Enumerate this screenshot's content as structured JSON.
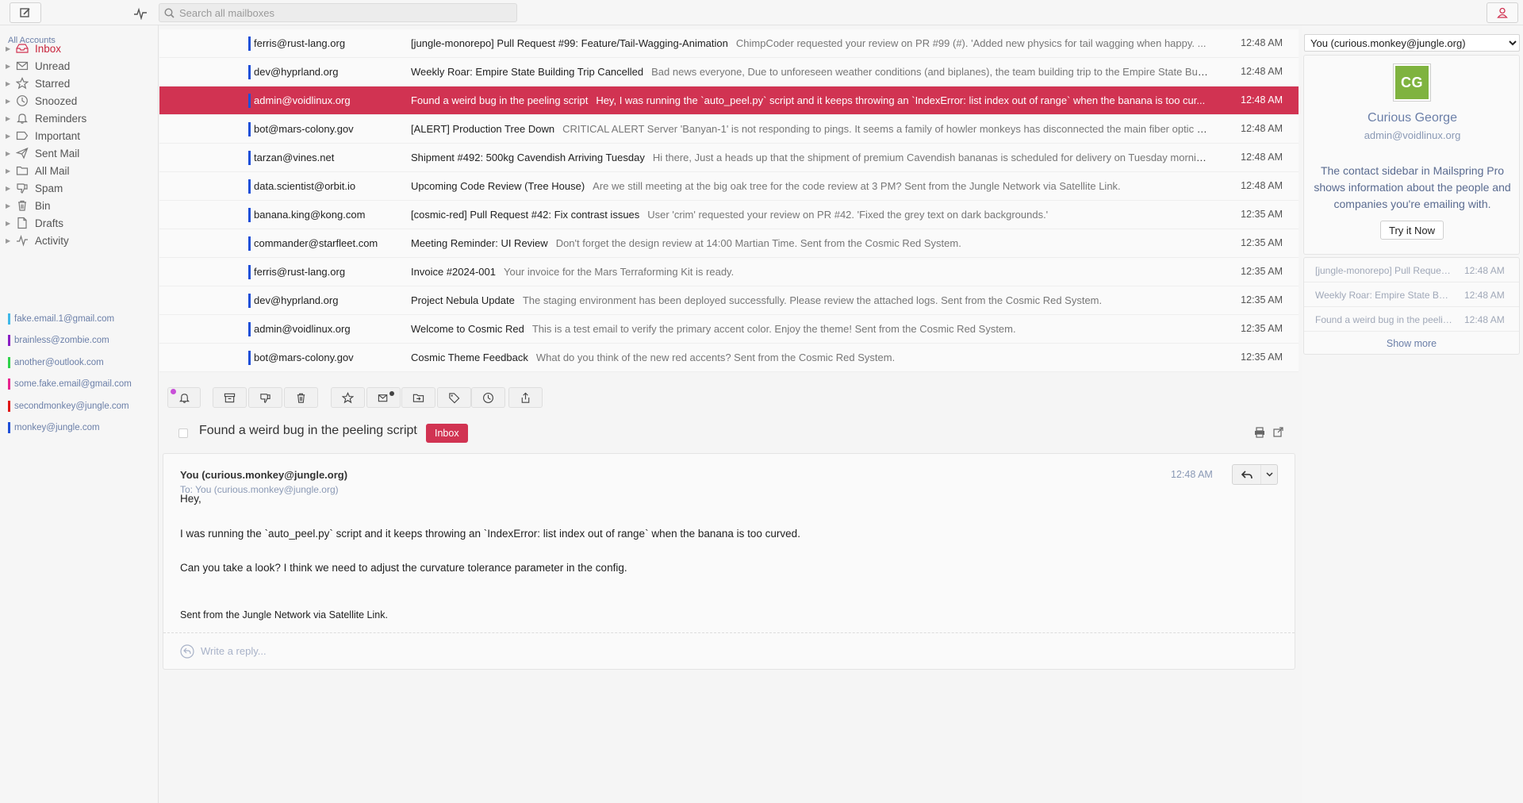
{
  "search": {
    "placeholder": "Search all mailboxes"
  },
  "sidebar": {
    "heading": "All Accounts",
    "folders": [
      {
        "label": "Inbox",
        "icon": "inbox-icon"
      },
      {
        "label": "Unread",
        "icon": "unread-icon"
      },
      {
        "label": "Starred",
        "icon": "star-icon"
      },
      {
        "label": "Snoozed",
        "icon": "clock-icon"
      },
      {
        "label": "Reminders",
        "icon": "bell-icon"
      },
      {
        "label": "Important",
        "icon": "label-icon"
      },
      {
        "label": "Sent Mail",
        "icon": "send-icon"
      },
      {
        "label": "All Mail",
        "icon": "folder-icon"
      },
      {
        "label": "Spam",
        "icon": "thumbs-down-icon"
      },
      {
        "label": "Bin",
        "icon": "trash-icon"
      },
      {
        "label": "Drafts",
        "icon": "draft-icon"
      },
      {
        "label": "Activity",
        "icon": "activity-icon"
      }
    ],
    "accounts": [
      {
        "label": "fake.email.1@gmail.com",
        "color": "#3fb8e8"
      },
      {
        "label": "brainless@zombie.com",
        "color": "#8a1fc4"
      },
      {
        "label": "another@outlook.com",
        "color": "#2fd24a"
      },
      {
        "label": "some.fake.email@gmail.com",
        "color": "#e8248f"
      },
      {
        "label": "secondmonkey@jungle.com",
        "color": "#e01616"
      },
      {
        "label": "monkey@jungle.com",
        "color": "#1f4fd8"
      }
    ]
  },
  "messages": [
    {
      "sender": "ferris@rust-lang.org",
      "subject": "[jungle-monorepo] Pull Request #99: Feature/Tail-Wagging-Animation",
      "snippet": "ChimpCoder requested your review on PR #99 (#). 'Added new physics for tail wagging when happy. ...",
      "time": "12:48 AM"
    },
    {
      "sender": "dev@hyprland.org",
      "subject": "Weekly Roar: Empire State Building Trip Cancelled",
      "snippet": "Bad news everyone, Due to unforeseen weather conditions (and biplanes), the team building trip to the Empire State Build...",
      "time": "12:48 AM"
    },
    {
      "sender": "admin@voidlinux.org",
      "subject": "Found a weird bug in the peeling script",
      "snippet": "Hey, I was running the `auto_peel.py` script and it keeps throwing an `IndexError: list index out of range` when the banana is too cur...",
      "time": "12:48 AM"
    },
    {
      "sender": "bot@mars-colony.gov",
      "subject": "[ALERT] Production Tree Down",
      "snippet": "CRITICAL ALERT Server 'Banyan-1' is not responding to pings. It seems a family of howler monkeys has disconnected the main fiber optic vi...",
      "time": "12:48 AM"
    },
    {
      "sender": "tarzan@vines.net",
      "subject": "Shipment #492: 500kg Cavendish Arriving Tuesday",
      "snippet": "Hi there, Just a heads up that the shipment of premium Cavendish bananas is scheduled for delivery on Tuesday morning...",
      "time": "12:48 AM"
    },
    {
      "sender": "data.scientist@orbit.io",
      "subject": "Upcoming Code Review (Tree House)",
      "snippet": "Are we still meeting at the big oak tree for the code review at 3 PM? Sent from the Jungle Network via Satellite Link.",
      "time": "12:48 AM"
    },
    {
      "sender": "banana.king@kong.com",
      "subject": "[cosmic-red] Pull Request #42: Fix contrast issues",
      "snippet": "User 'crim' requested your review on PR #42. 'Fixed the grey text on dark backgrounds.'",
      "time": "12:35 AM"
    },
    {
      "sender": "commander@starfleet.com",
      "subject": "Meeting Reminder: UI Review",
      "snippet": "Don't forget the design review at 14:00 Martian Time. Sent from the Cosmic Red System.",
      "time": "12:35 AM"
    },
    {
      "sender": "ferris@rust-lang.org",
      "subject": "Invoice #2024-001",
      "snippet": "Your invoice for the Mars Terraforming Kit is ready.",
      "time": "12:35 AM"
    },
    {
      "sender": "dev@hyprland.org",
      "subject": "Project Nebula Update",
      "snippet": "The staging environment has been deployed successfully. Please review the attached logs. Sent from the Cosmic Red System.",
      "time": "12:35 AM"
    },
    {
      "sender": "admin@voidlinux.org",
      "subject": "Welcome to Cosmic Red",
      "snippet": "This is a test email to verify the primary accent color. Enjoy the theme! Sent from the Cosmic Red System.",
      "time": "12:35 AM"
    },
    {
      "sender": "bot@mars-colony.gov",
      "subject": "Cosmic Theme Feedback",
      "snippet": "What do you think of the new red accents? Sent from the Cosmic Red System.",
      "time": "12:35 AM"
    }
  ],
  "selected_index": 2,
  "actions": [
    {
      "name": "reminder-button",
      "icon": "bell-icon"
    },
    {
      "name": "archive-button",
      "icon": "archive-icon"
    },
    {
      "name": "spam-button",
      "icon": "thumbs-down-icon"
    },
    {
      "name": "trash-button",
      "icon": "trash-icon"
    },
    {
      "name": "star-button",
      "icon": "star-icon"
    },
    {
      "name": "mark-unread-button",
      "icon": "mail-unread-icon"
    },
    {
      "name": "move-folder-button",
      "icon": "folder-move-icon"
    },
    {
      "name": "label-button",
      "icon": "tag-icon"
    },
    {
      "name": "snooze-button",
      "icon": "clock-icon"
    },
    {
      "name": "share-button",
      "icon": "share-icon"
    }
  ],
  "reader": {
    "subject": "Found a weird bug in the peeling script",
    "label": "Inbox",
    "from": "You (curious.monkey@jungle.org)",
    "to": "To: You (curious.monkey@jungle.org)",
    "time": "12:48 AM",
    "body": [
      "Hey,",
      "I was running the `auto_peel.py` script and it keeps throwing an `IndexError: list index out of range` when the banana is too curved.",
      "Can you take a look? I think we need to adjust the curvature tolerance parameter in the config."
    ],
    "signature": "Sent from the Jungle Network via Satellite Link.",
    "reply_placeholder": "Write a reply..."
  },
  "contact": {
    "select_value": "You (curious.monkey@jungle.org)",
    "initials": "CG",
    "avatar_color": "#7fb33f",
    "name": "Curious George",
    "email": "admin@voidlinux.org",
    "promo": "The contact sidebar in Mailspring Pro shows information about the people and companies you're emailing with.",
    "cta": "Try it Now",
    "threads": [
      {
        "subject": "[jungle-monorepo] Pull Request #99: Feature/Tail-Wagging-Animation",
        "time": "12:48 AM"
      },
      {
        "subject": "Weekly Roar: Empire State Building Trip Cancelled",
        "time": "12:48 AM"
      },
      {
        "subject": "Found a weird bug in the peeling script",
        "time": "12:48 AM"
      }
    ],
    "show_more": "Show more"
  },
  "colors": {
    "accent": "#d13352",
    "sender_bar": "#1f4fd8",
    "notification_dot": "#c84fd8"
  }
}
